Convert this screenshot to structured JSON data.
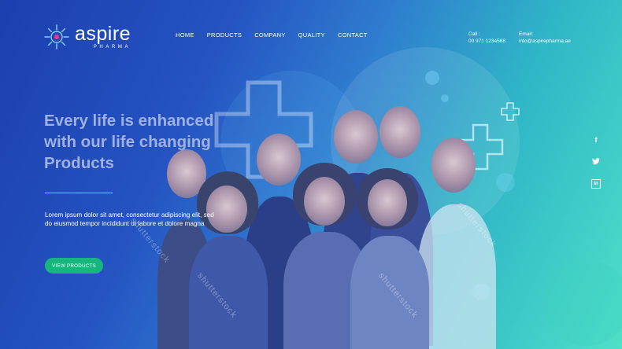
{
  "brand": {
    "name": "aspire",
    "sub": "PHARMA"
  },
  "nav": [
    {
      "label": "HOME"
    },
    {
      "label": "PRODUCTS"
    },
    {
      "label": "COMPANY"
    },
    {
      "label": "QUALITY"
    },
    {
      "label": "CONTACT"
    }
  ],
  "contact": {
    "call_label": "Call :",
    "call_value": "00 971 1234568",
    "email_label": "Email:",
    "email_value": "info@aspirepharma.ae"
  },
  "hero": {
    "headline": "Every life is enhanced with our life changing Products",
    "body": "Lorem ipsum dolor sit amet, consectetur adipiscing elit, sed do eiusmod tempor incididunt ut labore et dolore magna",
    "cta_label": "VIEW PRODUCTS"
  },
  "social": [
    {
      "icon": "facebook-icon",
      "glyph": "f"
    },
    {
      "icon": "twitter-icon",
      "glyph": "🐦"
    },
    {
      "icon": "linkedin-icon",
      "glyph": "in"
    }
  ],
  "watermark": "shutterstock",
  "colors": {
    "cta": "#17b67d",
    "headline": "#9fb1e0",
    "accent": "#e03a8f"
  }
}
